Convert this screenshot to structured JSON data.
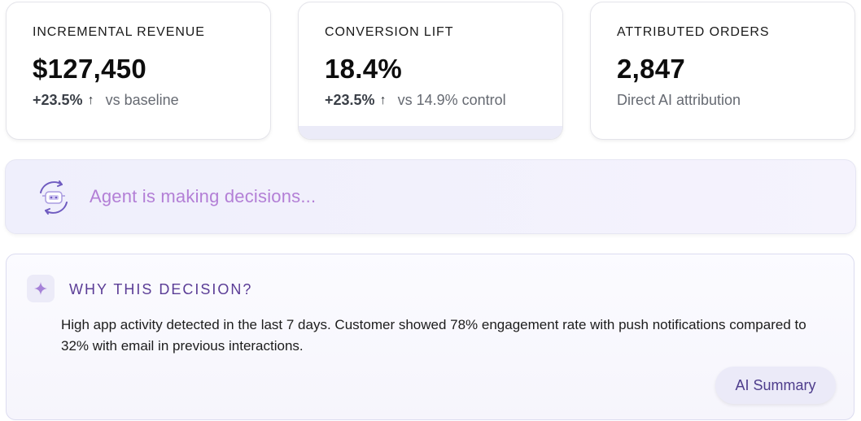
{
  "metrics": [
    {
      "label": "INCREMENTAL REVENUE",
      "value": "$127,450",
      "delta": "+23.5%",
      "arrow": "↑",
      "note": "vs baseline"
    },
    {
      "label": "CONVERSION LIFT",
      "value": "18.4%",
      "delta": "+23.5%",
      "arrow": "↑",
      "note": "vs 14.9% control"
    },
    {
      "label": "ATTRIBUTED ORDERS",
      "value": "2,847",
      "note": "Direct AI attribution"
    }
  ],
  "agent": {
    "status": "Agent is making decisions...",
    "icon": "robot-refresh-icon",
    "color": "#b37fd6"
  },
  "why": {
    "icon": "sparkle-icon",
    "title": "WHY THIS DECISION?",
    "body": "High app activity detected in the last 7 days. Customer showed 78% engagement rate with push notifications compared to 32% with email in previous interactions.",
    "button_label": "AI Summary"
  },
  "colors": {
    "accent": "#5b3d96",
    "agent_text": "#b37fd6",
    "muted_text": "#666a72"
  }
}
